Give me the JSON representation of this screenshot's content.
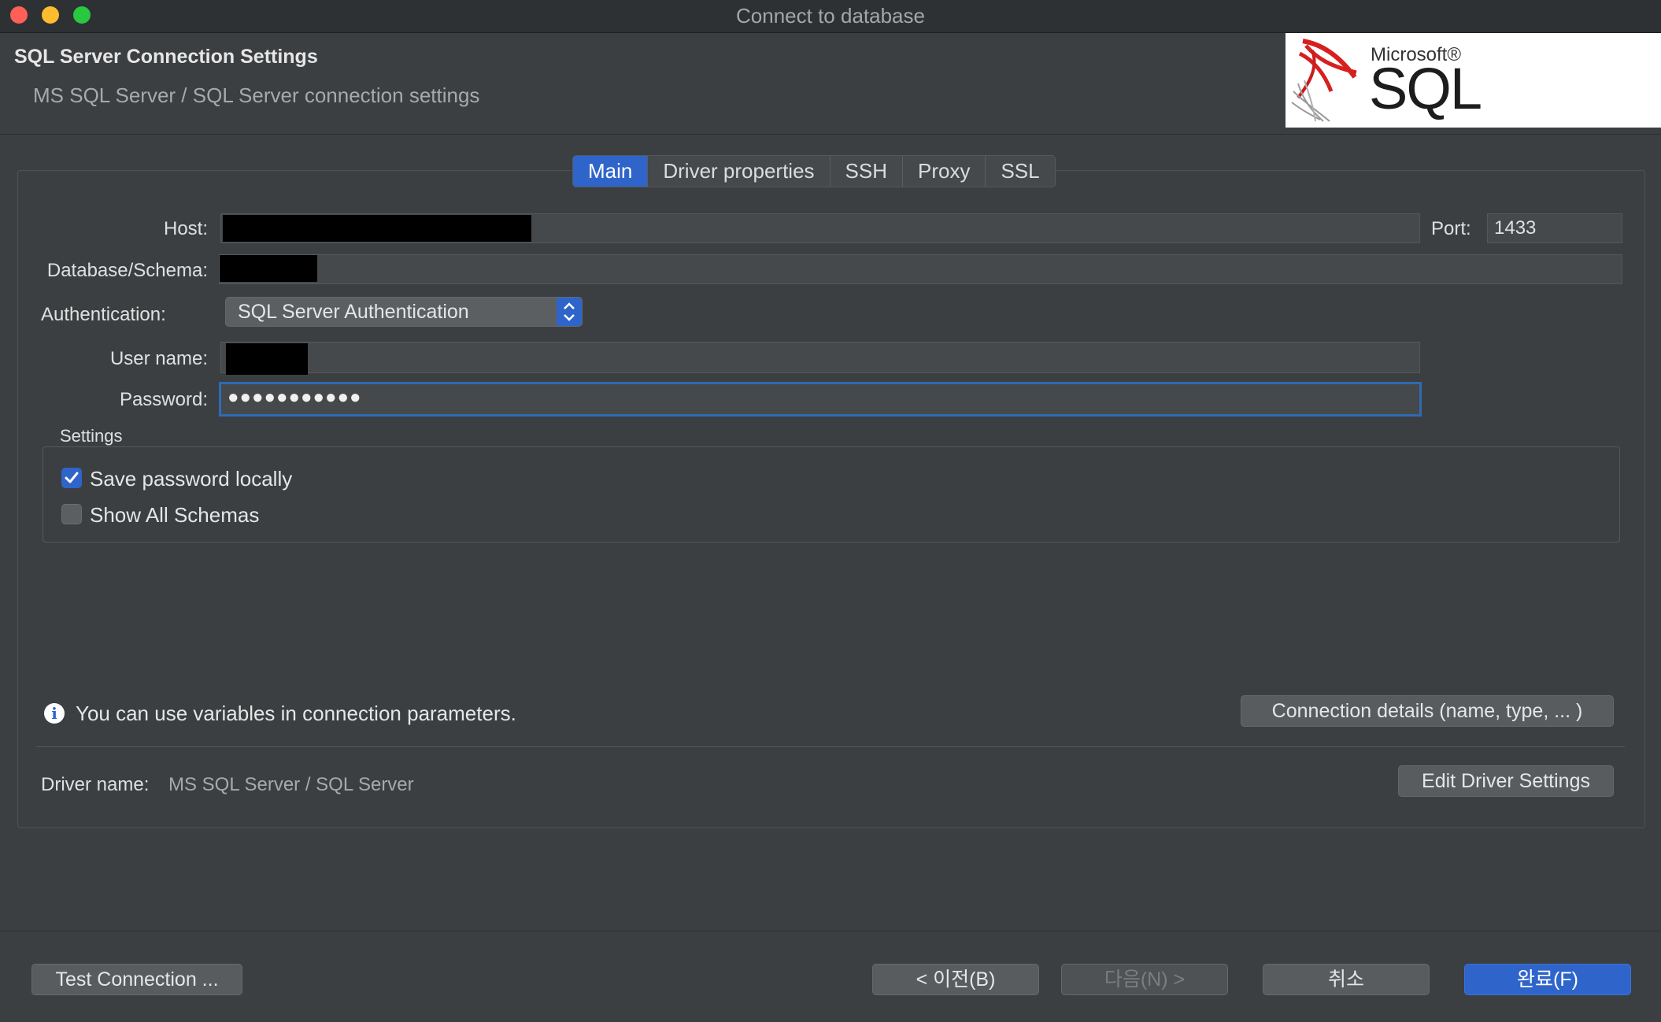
{
  "window": {
    "title": "Connect to database",
    "traffic_lights": [
      "close",
      "minimize",
      "maximize"
    ]
  },
  "header": {
    "title": "SQL Server Connection Settings",
    "subtitle": "MS SQL Server / SQL Server connection settings",
    "logo": {
      "brand_small": "Microsoft®",
      "brand_large": "SQL Server®"
    }
  },
  "tabs": [
    {
      "label": "Main",
      "active": true
    },
    {
      "label": "Driver properties",
      "active": false
    },
    {
      "label": "SSH",
      "active": false
    },
    {
      "label": "Proxy",
      "active": false
    },
    {
      "label": "SSL",
      "active": false
    }
  ],
  "form": {
    "host_label": "Host:",
    "host_value": "",
    "port_label": "Port:",
    "port_value": "1433",
    "database_label": "Database/Schema:",
    "database_value": "",
    "auth_label": "Authentication:",
    "auth_value": "SQL Server Authentication",
    "username_label": "User name:",
    "username_value": "",
    "password_label": "Password:",
    "password_value": "●●●●●●●●●●●"
  },
  "settings": {
    "group_label": "Settings",
    "save_password": {
      "label": "Save password locally",
      "checked": true
    },
    "show_all_schemas": {
      "label": "Show All Schemas",
      "checked": false
    }
  },
  "info": {
    "text": "You can use variables in connection parameters.",
    "details_button": "Connection details (name, type, ... )"
  },
  "driver": {
    "label": "Driver name:",
    "value": "MS SQL Server / SQL Server",
    "edit_button": "Edit Driver Settings"
  },
  "footer": {
    "test_button": "Test Connection ...",
    "prev_button": "< 이전(B)",
    "next_button": "다음(N) >",
    "cancel_button": "취소",
    "finish_button": "완료(F)"
  },
  "colors": {
    "accent": "#2f65ca",
    "background": "#3c3f41",
    "close": "#fe5f57",
    "minimize": "#febc2e",
    "maximize": "#28c840"
  }
}
